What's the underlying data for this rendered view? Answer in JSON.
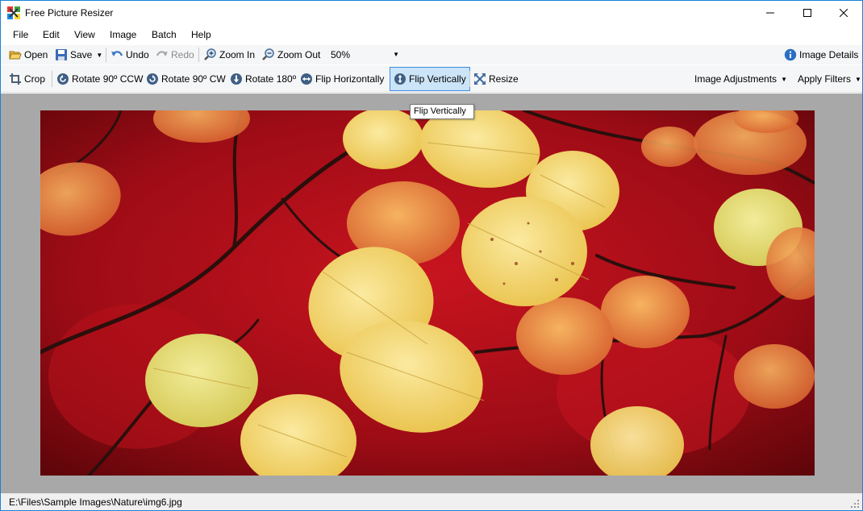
{
  "window": {
    "title": "Free Picture Resizer"
  },
  "menu": [
    "File",
    "Edit",
    "View",
    "Image",
    "Batch",
    "Help"
  ],
  "toolbar_main": {
    "open": "Open",
    "save": "Save",
    "undo": "Undo",
    "redo": "Redo",
    "zoom_in": "Zoom In",
    "zoom_out": "Zoom Out",
    "zoom_value": "50%",
    "image_details": "Image Details"
  },
  "toolbar_edit": {
    "crop": "Crop",
    "rotate_ccw": "Rotate 90º CCW",
    "rotate_cw": "Rotate 90º CW",
    "rotate_180": "Rotate 180º",
    "flip_h": "Flip Horizontally",
    "flip_v": "Flip Vertically",
    "resize": "Resize",
    "image_adjustments": "Image Adjustments",
    "apply_filters": "Apply Filters"
  },
  "tooltip": "Flip Vertically",
  "status": {
    "path": "E:\\Files\\Sample Images\\Nature\\img6.jpg"
  },
  "colors": {
    "accent": "#1883d7",
    "active_bg": "#cce4f7",
    "canvas_bg": "#a8a8a8",
    "photo_red": "#a8101a",
    "leaf_yellow": "#f3d97a",
    "leaf_orange": "#e9884a"
  }
}
